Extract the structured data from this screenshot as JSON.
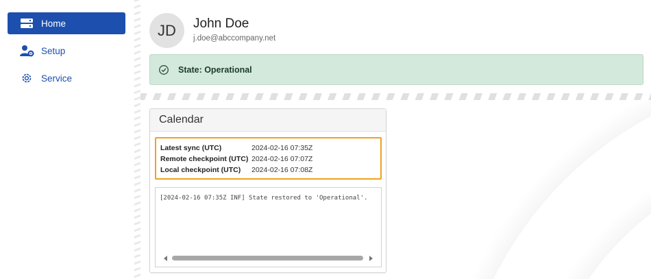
{
  "sidebar": {
    "items": [
      {
        "label": "Home",
        "icon": "server-icon",
        "active": true
      },
      {
        "label": "Setup",
        "icon": "user-gear-icon",
        "active": false
      },
      {
        "label": "Service",
        "icon": "gear-icon",
        "active": false
      }
    ]
  },
  "user": {
    "initials": "JD",
    "name": "John Doe",
    "email": "j.doe@abccompany.net"
  },
  "state": {
    "text": "State: Operational",
    "icon": "check-circle-icon"
  },
  "calendar": {
    "title": "Calendar",
    "rows": [
      {
        "label": "Latest sync (UTC)",
        "value": "2024-02-16 07:35Z"
      },
      {
        "label": "Remote checkpoint (UTC)",
        "value": "2024-02-16 07:07Z"
      },
      {
        "label": "Local checkpoint (UTC)",
        "value": "2024-02-16 07:08Z"
      }
    ],
    "log": [
      "[2024-02-16 07:35Z INF] State restored to 'Operational'."
    ]
  },
  "colors": {
    "accent": "#1c4fae",
    "state_bg": "#d3e9dc",
    "highlight": "#f0a020"
  }
}
